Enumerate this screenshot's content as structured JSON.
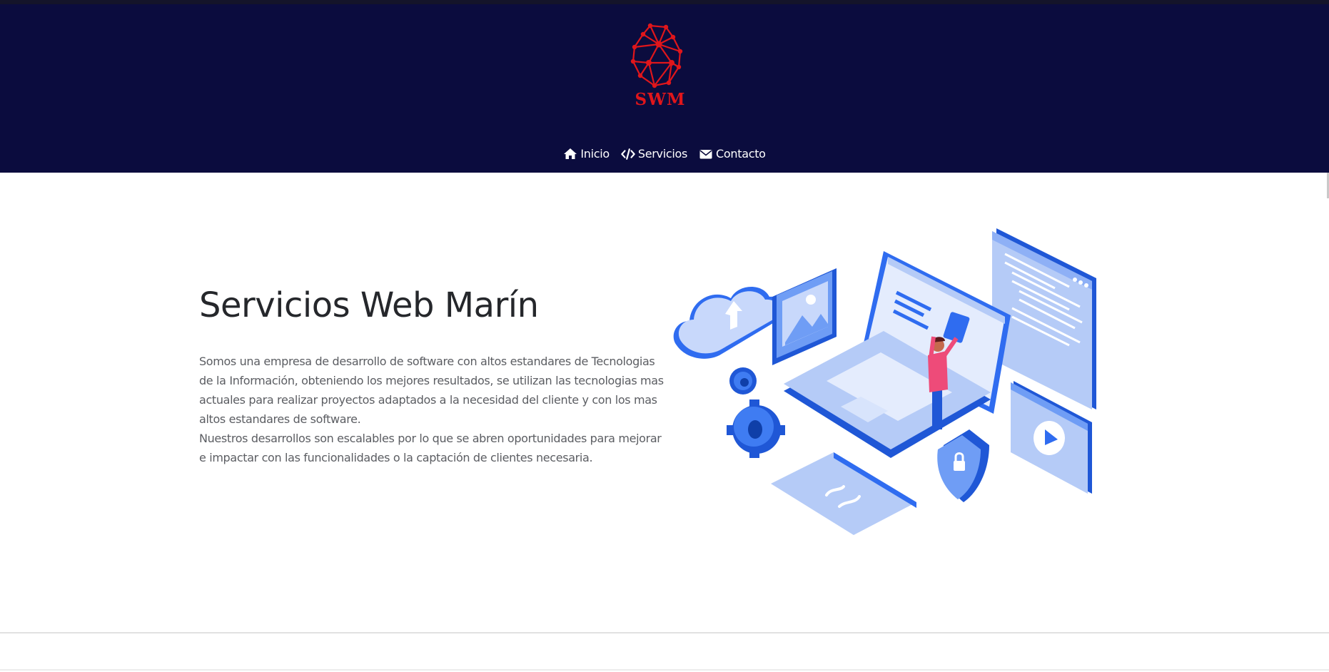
{
  "header": {
    "logo_text": "SWM",
    "nav": [
      {
        "label": "Inicio",
        "icon": "home-icon"
      },
      {
        "label": "Servicios",
        "icon": "code-icon"
      },
      {
        "label": "Contacto",
        "icon": "envelope-icon"
      }
    ]
  },
  "hero": {
    "title": "Servicios Web Marín",
    "paragraph_1": "Somos una empresa de desarrollo de software con altos estandares de Tecnologias de la Información, obteniendo los mejores resultados, se utilizan las tecnologias mas actuales para realizar proyectos adaptados a la necesidad del cliente y con los mas altos estandares de software.",
    "paragraph_2": "Nuestros desarrollos son escalables por lo que se abren oportunidades para mejorar e impactar con las funcionalidades o la captación de clientes necesaria."
  },
  "colors": {
    "header_bg": "#0b0c3e",
    "logo_red": "#e0161b",
    "illustration_blue": "#2f6cf0",
    "illustration_light": "#b5cbf7"
  }
}
